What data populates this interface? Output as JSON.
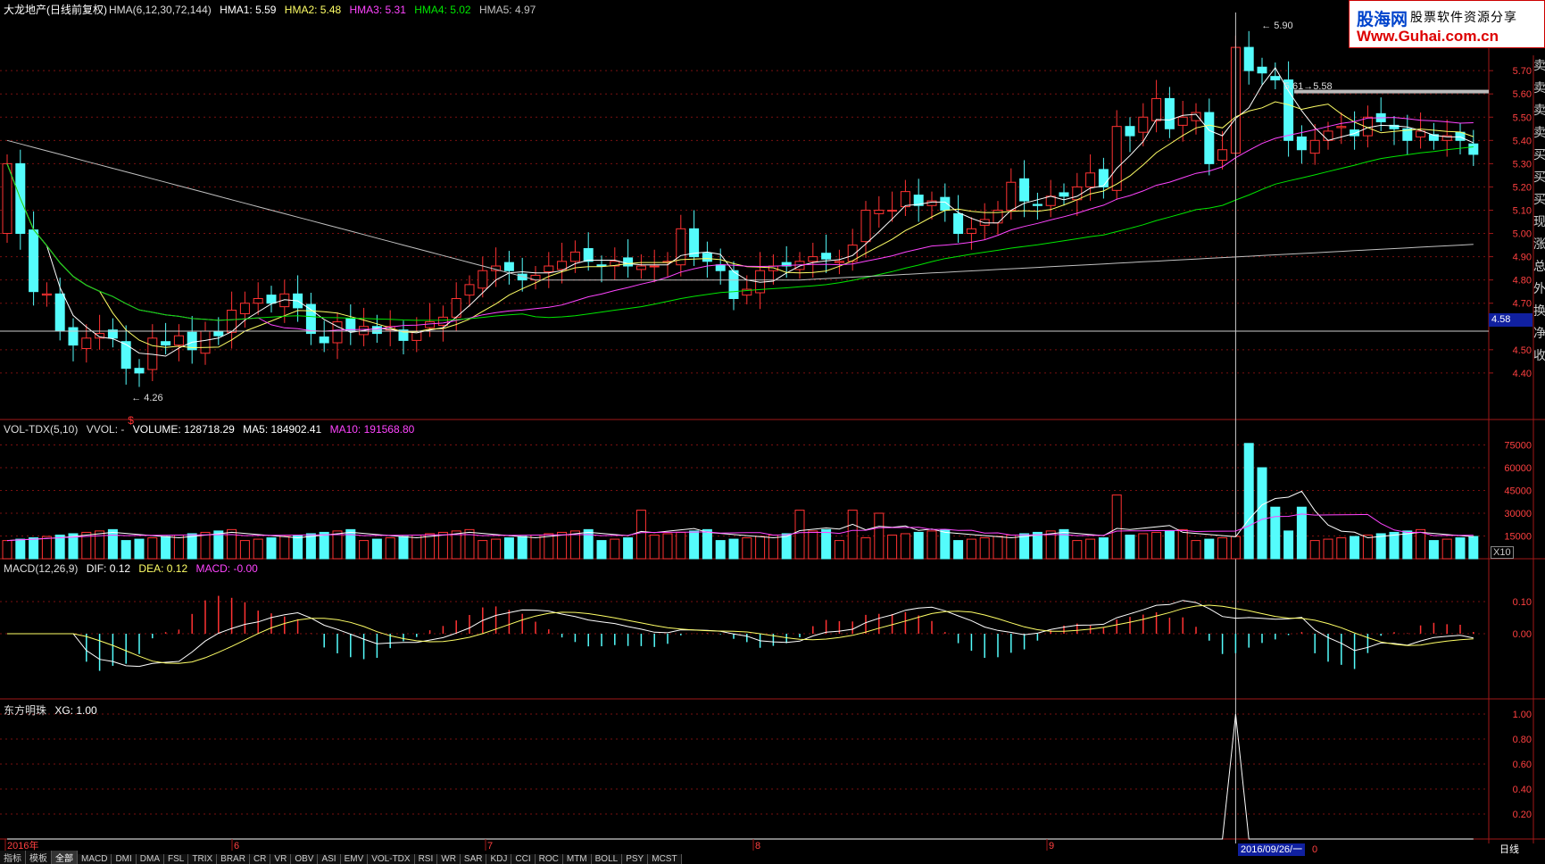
{
  "header": {
    "title": "大龙地产(日线前复权)",
    "indicator": "HMA(6,12,30,72,144)",
    "hma1": "HMA1: 5.59",
    "hma2": "HMA2: 5.48",
    "hma3": "HMA3: 5.31",
    "hma4": "HMA4: 5.02",
    "hma5": "HMA5: 4.97"
  },
  "vol_header": {
    "name": "VOL-TDX(5,10)",
    "vvol": "VVOL: -",
    "volume": "VOLUME: 128718.29",
    "ma5": "MA5: 184902.41",
    "ma10": "MA10: 191568.80"
  },
  "macd_header": {
    "name": "MACD(12,26,9)",
    "dif": "DIF: 0.12",
    "dea": "DEA: 0.12",
    "macd": "MACD: -0.00"
  },
  "xg_header": {
    "name": "东方明珠",
    "xg": "XG: 1.00"
  },
  "logo": {
    "brand": "股海网",
    "slogan": "股票软件资源分享",
    "url": "Www.Guhai.com.cn"
  },
  "price_tag": "4.58",
  "x10": "X10",
  "date_tag": "2016/09/26/一",
  "after_date": "0",
  "period": "日线",
  "annotations": {
    "high": "5.90",
    "low": "4.26",
    "mid": "5.61→5.58",
    "signal": "$"
  },
  "axis_x": [
    "2016年",
    "6",
    "7",
    "8",
    "9"
  ],
  "side_chars": [
    "卖",
    "卖",
    "卖",
    "卖",
    "买",
    "买",
    "买",
    "现",
    "涨",
    "总",
    "外",
    "换",
    "净",
    "收"
  ],
  "bottom_tabs": [
    "指标",
    "模板",
    "全部",
    "MACD",
    "DMI",
    "DMA",
    "FSL",
    "TRIX",
    "BRAR",
    "CR",
    "VR",
    "OBV",
    "ASI",
    "EMV",
    "VOL-TDX",
    "RSI",
    "WR",
    "SAR",
    "KDJ",
    "CCI",
    "ROC",
    "MTM",
    "BOLL",
    "PSY",
    "MCST"
  ],
  "axes": {
    "price": [
      "5.70",
      "5.60",
      "5.50",
      "5.40",
      "5.30",
      "5.20",
      "5.10",
      "5.00",
      "4.90",
      "4.80",
      "4.70",
      "4.50",
      "4.40"
    ],
    "volume": [
      "75000",
      "60000",
      "45000",
      "30000",
      "15000"
    ],
    "macd": [
      "0.10",
      "0.00"
    ],
    "xg": [
      "1.00",
      "0.80",
      "0.60",
      "0.40",
      "0.20"
    ]
  },
  "colors": {
    "up": "#ff3232",
    "down": "#54fcfc",
    "hma1": "#ffffff",
    "hma2": "#ffff66",
    "hma3": "#ff44ff",
    "hma4": "#00e600",
    "hma5": "#c0c0c0",
    "grid": "#7a1010"
  }
}
